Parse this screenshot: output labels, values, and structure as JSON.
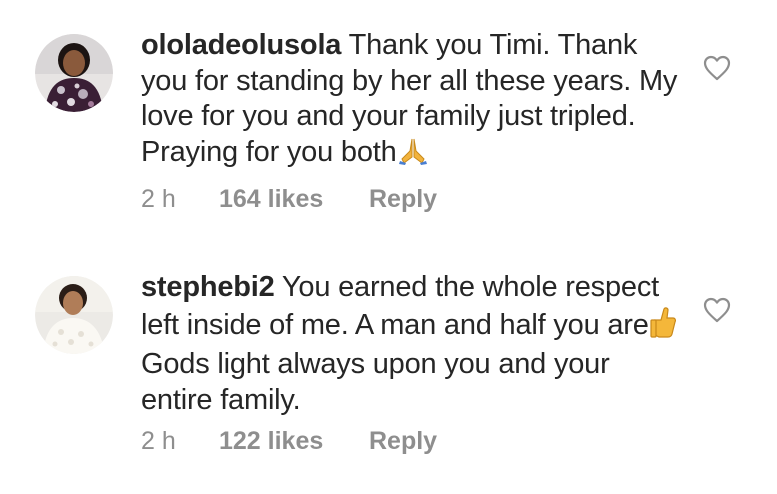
{
  "comments": [
    {
      "username": "ololadeolusola",
      "text": "Thank you Timi. Thank you for standing by her all these years. My love for you and your family just tripled. Praying for you both",
      "emoji": "folded-hands-emoji",
      "time": "2 h",
      "likes": "164 likes",
      "reply": "Reply",
      "avatar_icon": "avatar-woman-floral"
    },
    {
      "username": "stephebi2",
      "text_before_emoji": "You earned the whole respect left inside of me. A man and half you are",
      "emoji": "thumbs-up-emoji",
      "text_after_emoji": " Gods light always upon you and your entire family.",
      "time": "2 h",
      "likes": "122 likes",
      "reply": "Reply",
      "avatar_icon": "avatar-woman-lace"
    }
  ],
  "colors": {
    "text": "#262626",
    "meta": "#8e8e8e",
    "heart_stroke": "#8e8e8e",
    "background": "#ffffff"
  },
  "icons": {
    "like": "heart-outline-icon"
  }
}
